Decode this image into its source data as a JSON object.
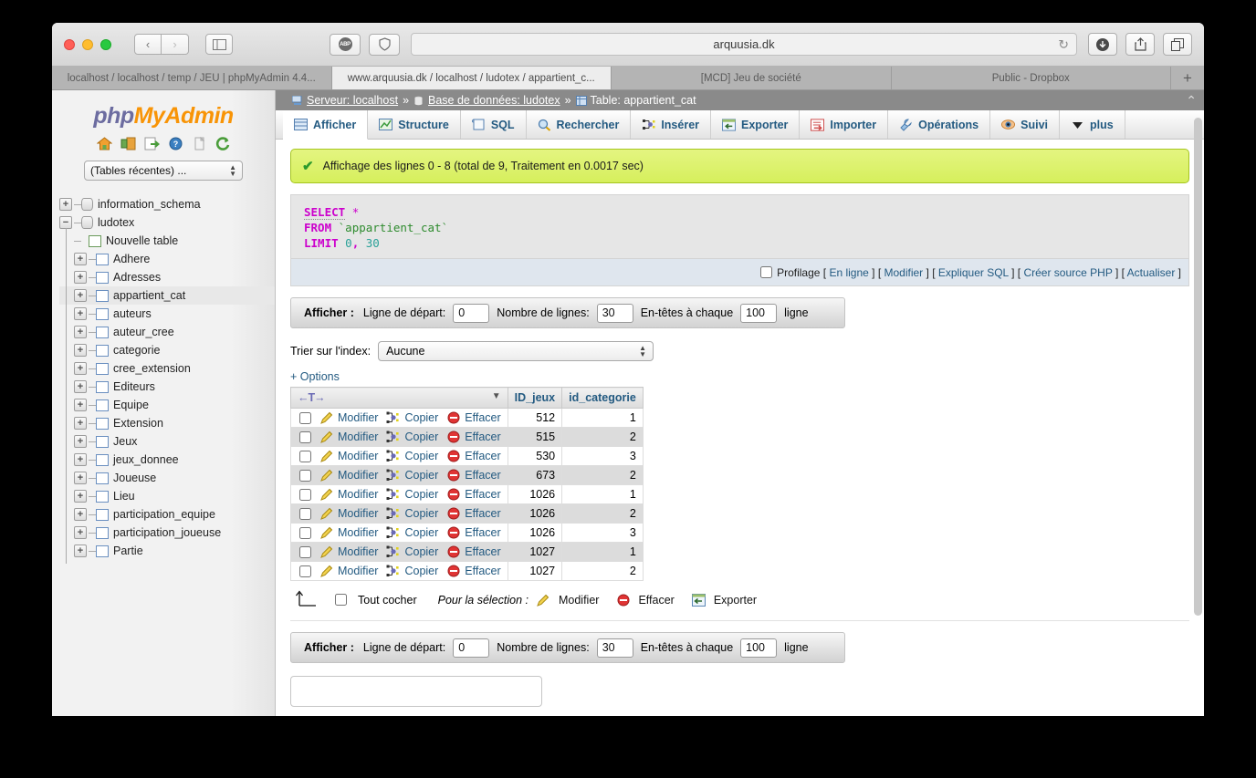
{
  "browser": {
    "url": "arquusia.dk",
    "nav": {
      "back": "‹",
      "forward": "›"
    },
    "reload_glyph": "↻",
    "abp_label": "ABP",
    "tabs": [
      {
        "title": "localhost / localhost / temp / JEU | phpMyAdmin 4.4...",
        "active": false
      },
      {
        "title": "www.arquusia.dk / localhost / ludotex / appartient_c...",
        "active": true
      },
      {
        "title": "[MCD] Jeu de société",
        "active": false
      },
      {
        "title": "Public - Dropbox",
        "active": false
      }
    ],
    "new_tab": "+"
  },
  "sidebar": {
    "logo": {
      "php": "php",
      "my": "My",
      "admin": "Admin"
    },
    "quick_icons": [
      {
        "name": "home-icon",
        "glyph": "⌂"
      },
      {
        "name": "logout-icon",
        "glyph": "⎆"
      },
      {
        "name": "sql-export-icon",
        "glyph": "⇨"
      },
      {
        "name": "help-icon",
        "glyph": "?"
      },
      {
        "name": "docs-icon",
        "glyph": "▤"
      },
      {
        "name": "reload-icon",
        "glyph": "↻"
      }
    ],
    "recent_tables": "(Tables récentes) ...",
    "tree": [
      {
        "label": "information_schema",
        "type": "db",
        "expanded": false,
        "selected": false,
        "depth": 0
      },
      {
        "label": "ludotex",
        "type": "db",
        "expanded": true,
        "selected": false,
        "depth": 0
      },
      {
        "label": "Nouvelle table",
        "type": "new-table",
        "expanded": null,
        "selected": false,
        "depth": 1
      },
      {
        "label": "Adhere",
        "type": "table",
        "expanded": false,
        "selected": false,
        "depth": 1
      },
      {
        "label": "Adresses",
        "type": "table",
        "expanded": false,
        "selected": false,
        "depth": 1
      },
      {
        "label": "appartient_cat",
        "type": "table",
        "expanded": false,
        "selected": true,
        "depth": 1
      },
      {
        "label": "auteurs",
        "type": "table",
        "expanded": false,
        "selected": false,
        "depth": 1
      },
      {
        "label": "auteur_cree",
        "type": "table",
        "expanded": false,
        "selected": false,
        "depth": 1
      },
      {
        "label": "categorie",
        "type": "table",
        "expanded": false,
        "selected": false,
        "depth": 1
      },
      {
        "label": "cree_extension",
        "type": "table",
        "expanded": false,
        "selected": false,
        "depth": 1
      },
      {
        "label": "Editeurs",
        "type": "table",
        "expanded": false,
        "selected": false,
        "depth": 1
      },
      {
        "label": "Equipe",
        "type": "table",
        "expanded": false,
        "selected": false,
        "depth": 1
      },
      {
        "label": "Extension",
        "type": "table",
        "expanded": false,
        "selected": false,
        "depth": 1
      },
      {
        "label": "Jeux",
        "type": "table",
        "expanded": false,
        "selected": false,
        "depth": 1
      },
      {
        "label": "jeux_donnee",
        "type": "table",
        "expanded": false,
        "selected": false,
        "depth": 1
      },
      {
        "label": "Joueuse",
        "type": "table",
        "expanded": false,
        "selected": false,
        "depth": 1
      },
      {
        "label": "Lieu",
        "type": "table",
        "expanded": false,
        "selected": false,
        "depth": 1
      },
      {
        "label": "participation_equipe",
        "type": "table",
        "expanded": false,
        "selected": false,
        "depth": 1
      },
      {
        "label": "participation_joueuse",
        "type": "table",
        "expanded": false,
        "selected": false,
        "depth": 1
      },
      {
        "label": "Partie",
        "type": "table",
        "expanded": false,
        "selected": false,
        "depth": 1
      }
    ]
  },
  "breadcrumb": {
    "server_label": "Serveur: localhost",
    "sep1": "»",
    "db_label": "Base de données: ludotex",
    "sep2": "»",
    "table_label": "Table: appartient_cat",
    "collapse_glyph": "⌃"
  },
  "main_tabs": [
    {
      "label": "Afficher",
      "icon": "browse-icon",
      "active": true
    },
    {
      "label": "Structure",
      "icon": "structure-icon",
      "active": false
    },
    {
      "label": "SQL",
      "icon": "sql-icon",
      "active": false
    },
    {
      "label": "Rechercher",
      "icon": "search-icon",
      "active": false
    },
    {
      "label": "Insérer",
      "icon": "insert-icon",
      "active": false
    },
    {
      "label": "Exporter",
      "icon": "export-icon",
      "active": false
    },
    {
      "label": "Importer",
      "icon": "import-icon",
      "active": false
    },
    {
      "label": "Opérations",
      "icon": "operations-icon",
      "active": false
    },
    {
      "label": "Suivi",
      "icon": "tracking-icon",
      "active": false
    },
    {
      "label": "plus",
      "icon": "chevron-down-icon",
      "active": false
    }
  ],
  "alert": {
    "text": "Affichage des lignes 0 - 8 (total de 9, Traitement en 0.0017 sec)",
    "icon": "check-icon",
    "color": "#d6ef5c"
  },
  "sql": {
    "line1_kw": "SELECT",
    "line1_star": "*",
    "line2_kw": "FROM",
    "line2_table": "`appartient_cat`",
    "line3_kw": "LIMIT",
    "line3_a": "0",
    "line3_comma": ",",
    "line3_b": "30",
    "footer": {
      "profiling_label": "Profilage",
      "links": [
        "En ligne",
        "Modifier",
        "Expliquer SQL",
        "Créer source PHP",
        "Actualiser"
      ]
    }
  },
  "display_bar": {
    "title": "Afficher :",
    "start_label": "Ligne de départ:",
    "start_value": "0",
    "rows_label": "Nombre de lignes:",
    "rows_value": "30",
    "headers_label": "En-têtes à chaque",
    "headers_value": "100",
    "headers_suffix": "ligne"
  },
  "sort": {
    "label": "Trier sur l'index:",
    "value": "Aucune"
  },
  "options_link": "+ Options",
  "table": {
    "headers": [
      "",
      "ID_jeux",
      "id_categorie"
    ],
    "actions": {
      "edit": "Modifier",
      "copy": "Copier",
      "delete": "Effacer"
    },
    "sort_glyph": "←T→",
    "rows": [
      {
        "ID_jeux": "512",
        "id_categorie": "1"
      },
      {
        "ID_jeux": "515",
        "id_categorie": "2"
      },
      {
        "ID_jeux": "530",
        "id_categorie": "3"
      },
      {
        "ID_jeux": "673",
        "id_categorie": "2"
      },
      {
        "ID_jeux": "1026",
        "id_categorie": "1"
      },
      {
        "ID_jeux": "1026",
        "id_categorie": "2"
      },
      {
        "ID_jeux": "1026",
        "id_categorie": "3"
      },
      {
        "ID_jeux": "1027",
        "id_categorie": "1"
      },
      {
        "ID_jeux": "1027",
        "id_categorie": "2"
      }
    ]
  },
  "selection_bar": {
    "check_all": "Tout cocher",
    "for_selection": "Pour la sélection :",
    "edit": "Modifier",
    "delete": "Effacer",
    "export": "Exporter"
  }
}
